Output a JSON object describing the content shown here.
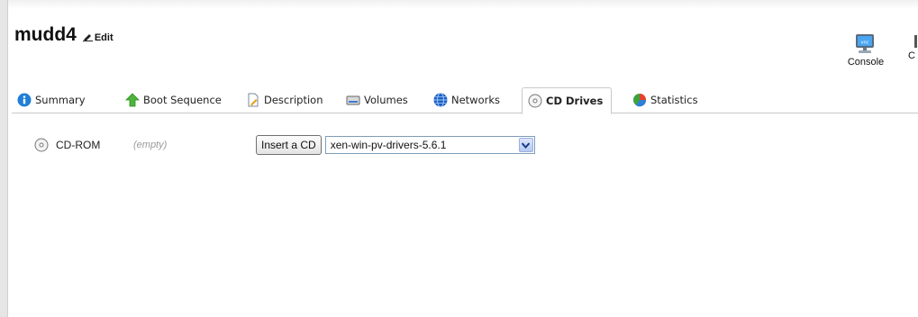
{
  "header": {
    "vm_name": "mudd4",
    "edit_label": "Edit"
  },
  "toolbar": {
    "console_label": "Console",
    "next_label": "C"
  },
  "tabs": [
    {
      "label": "Summary",
      "icon": "info-icon"
    },
    {
      "label": "Boot Sequence",
      "icon": "up-arrow-icon"
    },
    {
      "label": "Description",
      "icon": "document-icon"
    },
    {
      "label": "Volumes",
      "icon": "disk-icon"
    },
    {
      "label": "Networks",
      "icon": "globe-icon"
    },
    {
      "label": "CD Drives",
      "icon": "cd-icon",
      "active": true
    },
    {
      "label": "Statistics",
      "icon": "pie-chart-icon"
    }
  ],
  "cd_drives": {
    "drive_label": "CD-ROM",
    "drive_status": "(empty)",
    "insert_button": "Insert a CD",
    "selected_iso": "xen-win-pv-drivers-5.6.1"
  }
}
